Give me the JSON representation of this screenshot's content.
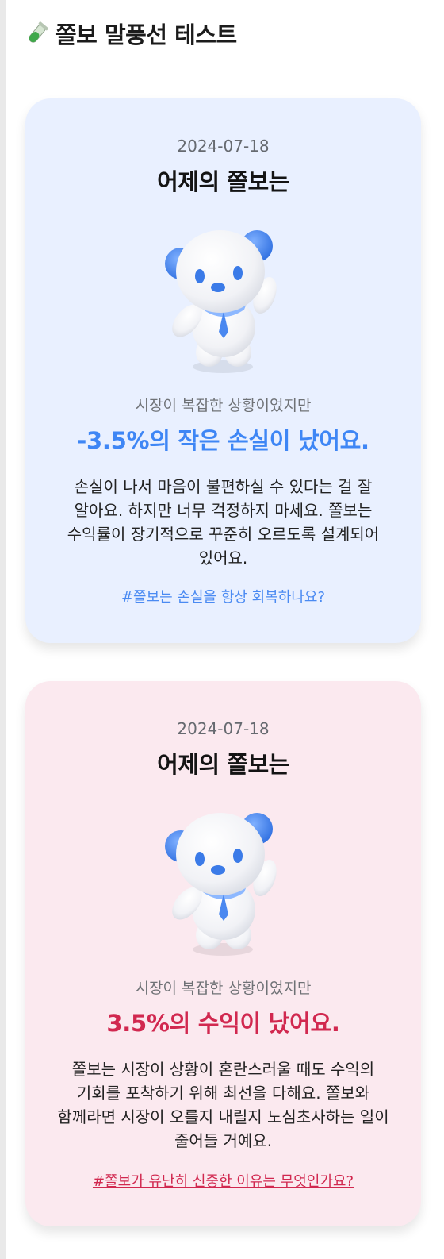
{
  "header": {
    "emoji_icon": "test-tube-icon",
    "title": "쫄보 말풍선 테스트"
  },
  "cards": [
    {
      "variant": "loss",
      "background": "#e9f0ff",
      "accent": "#3e86f5",
      "date": "2024-07-18",
      "heading": "어제의 쫄보는",
      "mascot_icon": "bear-mascot-icon",
      "intro": "시장이 복잡한 상황이었지만",
      "result": "-3.5%의 작은 손실이 났어요.",
      "body": "손실이 나서 마음이 불편하실 수 있다는 걸 잘 알아요. 하지만 너무 걱정하지 마세요. 쫄보는 수익률이 장기적으로 꾸준히 오르도록 설계되어 있어요.",
      "link": "#쫄보는 손실을 항상 회복하나요?"
    },
    {
      "variant": "gain",
      "background": "#fbe9ef",
      "accent": "#d1284f",
      "date": "2024-07-18",
      "heading": "어제의 쫄보는",
      "mascot_icon": "bear-mascot-icon",
      "intro": "시장이 복잡한 상황이었지만",
      "result": "3.5%의 수익이 났어요.",
      "body": "쫄보는 시장이 상황이 혼란스러울 때도 수익의 기회를 포착하기 위해 최선을 다해요. 쫄보와 함께라면 시장이 오를지 내릴지 노심초사하는 일이 줄어들 거예요.",
      "link": "#쫄보가 유난히 신중한 이유는 무엇인가요?"
    }
  ]
}
